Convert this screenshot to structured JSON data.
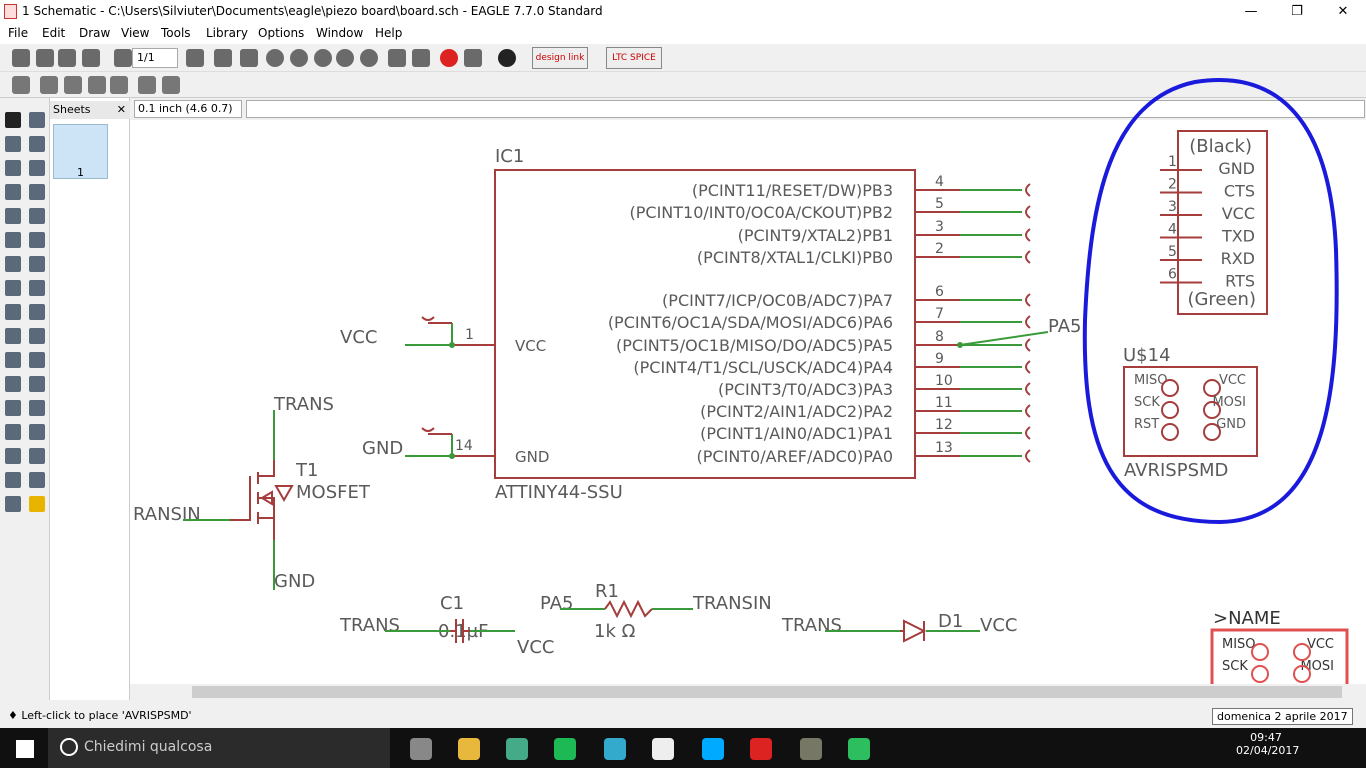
{
  "window": {
    "title": "1 Schematic - C:\\Users\\Silviuter\\Documents\\eagle\\piezo board\\board.sch - EAGLE 7.7.0 Standard",
    "minimize": "—",
    "maximize": "❐",
    "close": "✕"
  },
  "menu": [
    "File",
    "Edit",
    "Draw",
    "View",
    "Tools",
    "Library",
    "Options",
    "Window",
    "Help"
  ],
  "toolbar": {
    "sheet_select": "1/1",
    "designlink": "design link",
    "ltspice": "LTC SPICE"
  },
  "sheets": {
    "title": "Sheets",
    "thumb_label": "1"
  },
  "coord": "0.1 inch (4.6 0.7)",
  "command_input": "",
  "status": "♦ Left-click to place 'AVRISPSMD'",
  "tooltip": "domenica 2 aprile 2017",
  "taskbar": {
    "search": "Chiedimi qualcosa",
    "time": "09:47",
    "date": "02/04/2017"
  },
  "colors": {
    "net": "#3a9a3a",
    "symbol": "#a53d3d",
    "text": "#5a5a5a",
    "annotation": "#1a1adc",
    "selected": "#e05050"
  },
  "schematic": {
    "ic": {
      "name": "IC1",
      "value": "ATTINY44-SSU",
      "right_pins": [
        {
          "label": "(PCINT11/RESET/DW)PB3",
          "num": "4"
        },
        {
          "label": "(PCINT10/INT0/OC0A/CKOUT)PB2",
          "num": "5"
        },
        {
          "label": "(PCINT9/XTAL2)PB1",
          "num": "3"
        },
        {
          "label": "(PCINT8/XTAL1/CLKI)PB0",
          "num": "2"
        },
        {
          "label": "(PCINT7/ICP/OC0B/ADC7)PA7",
          "num": "6"
        },
        {
          "label": "(PCINT6/OC1A/SDA/MOSI/ADC6)PA6",
          "num": "7"
        },
        {
          "label": "(PCINT5/OC1B/MISO/DO/ADC5)PA5",
          "num": "8"
        },
        {
          "label": "(PCINT4/T1/SCL/USCK/ADC4)PA4",
          "num": "9"
        },
        {
          "label": "(PCINT3/T0/ADC3)PA3",
          "num": "10"
        },
        {
          "label": "(PCINT2/AIN1/ADC2)PA2",
          "num": "11"
        },
        {
          "label": "(PCINT1/AIN0/ADC1)PA1",
          "num": "12"
        },
        {
          "label": "(PCINT0/AREF/ADC0)PA0",
          "num": "13"
        }
      ],
      "left_pins": [
        {
          "label": "VCC",
          "num": "1",
          "net": "VCC"
        },
        {
          "label": "GND",
          "num": "14",
          "net": "GND"
        }
      ],
      "pa5_label": "PA5"
    },
    "ftdi": {
      "top": "(Black)",
      "bottom": "(Green)",
      "pins": [
        {
          "n": "1",
          "l": "GND"
        },
        {
          "n": "2",
          "l": "CTS"
        },
        {
          "n": "3",
          "l": "VCC"
        },
        {
          "n": "4",
          "l": "TXD"
        },
        {
          "n": "5",
          "l": "RXD"
        },
        {
          "n": "6",
          "l": "RTS"
        }
      ]
    },
    "isp": {
      "name": "U$14",
      "value": "AVRISPSMD",
      "left": [
        "MISO",
        "SCK",
        "RST"
      ],
      "right": [
        "VCC",
        "MOSI",
        "GND"
      ]
    },
    "mosfet": {
      "name": "T1",
      "value": "MOSFET",
      "drain": "TRANS",
      "gate": "RANSIN",
      "source": "GND"
    },
    "cap": {
      "name": "C1",
      "value": "0.1µF",
      "left": "TRANS",
      "right": "VCC"
    },
    "res": {
      "name": "R1",
      "value": "1k Ω",
      "left": "PA5",
      "right": "TRANSIN"
    },
    "diode": {
      "name": "D1",
      "left": "TRANS",
      "right": "VCC"
    },
    "ghost": {
      "name": ">NAME",
      "labels": [
        "MISO",
        "VCC",
        "SCK",
        "MOSI"
      ]
    }
  }
}
